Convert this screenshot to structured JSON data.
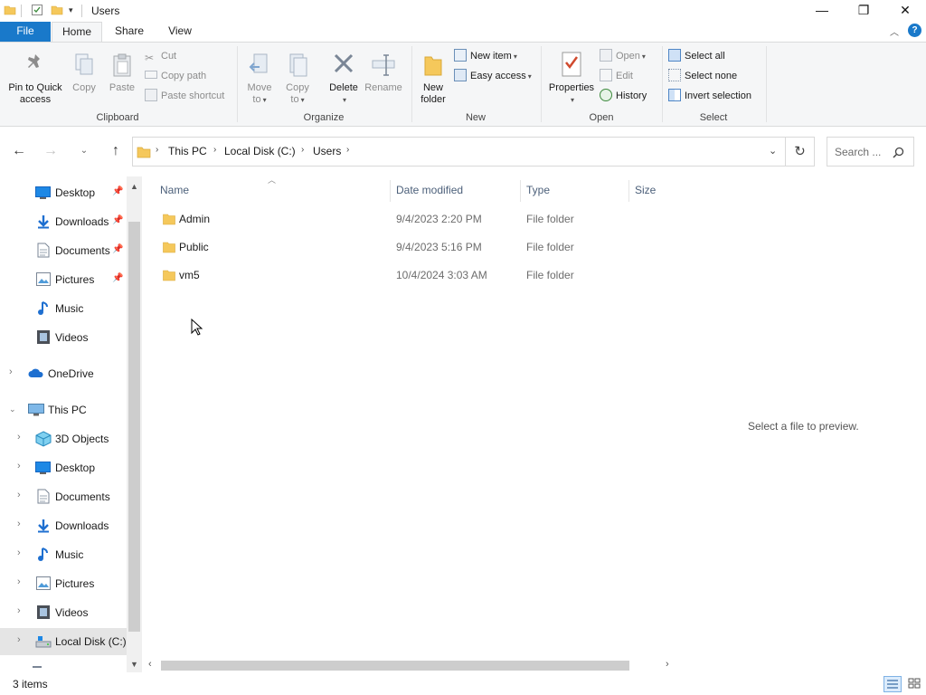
{
  "window": {
    "title": "Users",
    "controls": {
      "minimize": "—",
      "maximize": "❐",
      "close": "✕"
    }
  },
  "ribbon_tabs": [
    {
      "label": "File"
    },
    {
      "label": "Home"
    },
    {
      "label": "Share"
    },
    {
      "label": "View"
    }
  ],
  "ribbon": {
    "clipboard": {
      "group_label": "Clipboard",
      "pin_label_1": "Pin to Quick",
      "pin_label_2": "access",
      "copy": "Copy",
      "paste": "Paste",
      "cut": "Cut",
      "copy_path": "Copy path",
      "paste_shortcut": "Paste shortcut"
    },
    "organize": {
      "group_label": "Organize",
      "move_to_1": "Move",
      "move_to_2": "to",
      "copy_to_1": "Copy",
      "copy_to_2": "to",
      "delete": "Delete",
      "rename": "Rename"
    },
    "new": {
      "group_label": "New",
      "new_folder_1": "New",
      "new_folder_2": "folder",
      "new_item": "New item",
      "easy_access": "Easy access"
    },
    "open": {
      "group_label": "Open",
      "properties": "Properties",
      "open": "Open",
      "edit": "Edit",
      "history": "History"
    },
    "select": {
      "group_label": "Select",
      "select_all": "Select all",
      "select_none": "Select none",
      "invert_selection": "Invert selection"
    }
  },
  "address": {
    "crumbs": [
      "This PC",
      "Local Disk (C:)",
      "Users"
    ],
    "search_placeholder": "Search ..."
  },
  "nav_pane": {
    "quick_access": [
      {
        "label": "Desktop",
        "icon": "desktop-icon",
        "pinned": true
      },
      {
        "label": "Downloads",
        "icon": "downloads-icon",
        "pinned": true
      },
      {
        "label": "Documents",
        "icon": "documents-icon",
        "pinned": true
      },
      {
        "label": "Pictures",
        "icon": "pictures-icon",
        "pinned": true
      },
      {
        "label": "Music",
        "icon": "music-icon",
        "pinned": false
      },
      {
        "label": "Videos",
        "icon": "videos-icon",
        "pinned": false
      }
    ],
    "onedrive": "OneDrive",
    "this_pc": "This PC",
    "this_pc_items": [
      {
        "label": "3D Objects",
        "icon": "3d-objects-icon"
      },
      {
        "label": "Desktop",
        "icon": "desktop-icon"
      },
      {
        "label": "Documents",
        "icon": "documents-icon"
      },
      {
        "label": "Downloads",
        "icon": "downloads-icon"
      },
      {
        "label": "Music",
        "icon": "music-icon"
      },
      {
        "label": "Pictures",
        "icon": "pictures-icon"
      },
      {
        "label": "Videos",
        "icon": "videos-icon"
      },
      {
        "label": "Local Disk (C:)",
        "icon": "local-disk-icon",
        "selected": true
      }
    ]
  },
  "file_list": {
    "columns": {
      "name": "Name",
      "date": "Date modified",
      "type": "Type",
      "size": "Size"
    },
    "rows": [
      {
        "name": "Admin",
        "date": "9/4/2023 2:20 PM",
        "type": "File folder"
      },
      {
        "name": "Public",
        "date": "9/4/2023 5:16 PM",
        "type": "File folder"
      },
      {
        "name": "vm5",
        "date": "10/4/2024 3:03 AM",
        "type": "File folder"
      }
    ]
  },
  "preview": {
    "message": "Select a file to preview."
  },
  "status": {
    "item_count": "3 items"
  },
  "colors": {
    "accent": "#1979ca",
    "folder": "#f5c85b",
    "ribbon_bg": "#f5f6f7"
  }
}
